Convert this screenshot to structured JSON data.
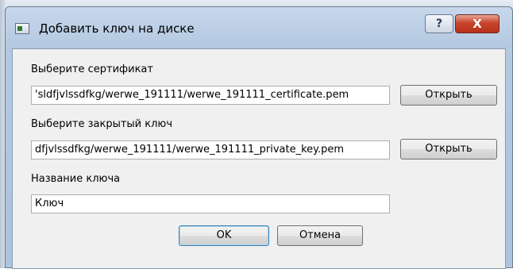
{
  "window": {
    "title": "Добавить ключ на диске",
    "help_label": "?",
    "close_label": "X"
  },
  "certificate": {
    "label": "Выберите сертификат",
    "path": "'sldfjvlssdfkg/werwe_191111/werwe_191111_certificate.pem",
    "open_label": "Открыть"
  },
  "private_key": {
    "label": "Выберите закрытый ключ",
    "path": "dfjvlssdfkg/werwe_191111/werwe_191111_private_key.pem",
    "open_label": "Открыть"
  },
  "key_name": {
    "label": "Название ключа",
    "value": "Ключ"
  },
  "buttons": {
    "ok_label": "OK",
    "cancel_label": "Отмена"
  }
}
